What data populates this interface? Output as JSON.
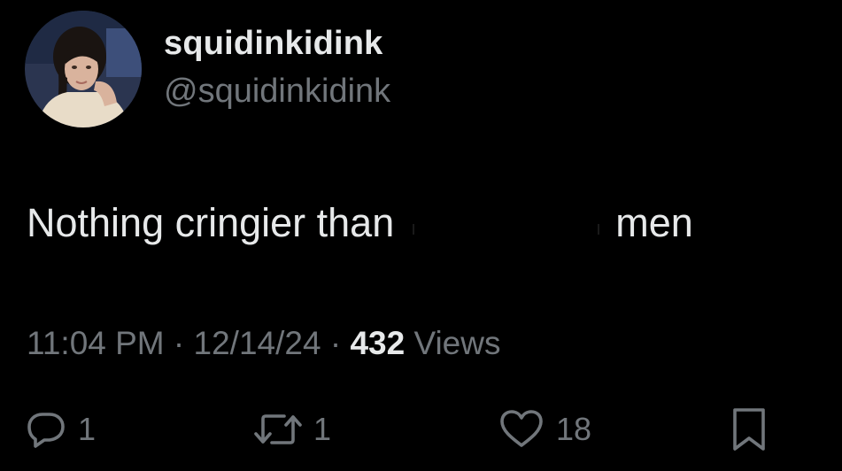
{
  "tweet": {
    "author": {
      "display_name": "squidinkidink",
      "handle": "@squidinkidink",
      "avatar_icon": "profile-photo"
    },
    "text_before": "Nothing cringier than",
    "text_after": "men",
    "time": "11:04 PM",
    "date": "12/14/24",
    "separator": "·",
    "views_count": "432",
    "views_label": "Views"
  },
  "actions": {
    "reply": {
      "icon": "reply-icon",
      "count": "1"
    },
    "repost": {
      "icon": "repost-icon",
      "count": "1"
    },
    "like": {
      "icon": "heart-icon",
      "count": "18"
    },
    "bookmark": {
      "icon": "bookmark-icon"
    }
  },
  "colors": {
    "background": "#000000",
    "primary_text": "#e7e9ea",
    "secondary_text": "#71767b"
  }
}
